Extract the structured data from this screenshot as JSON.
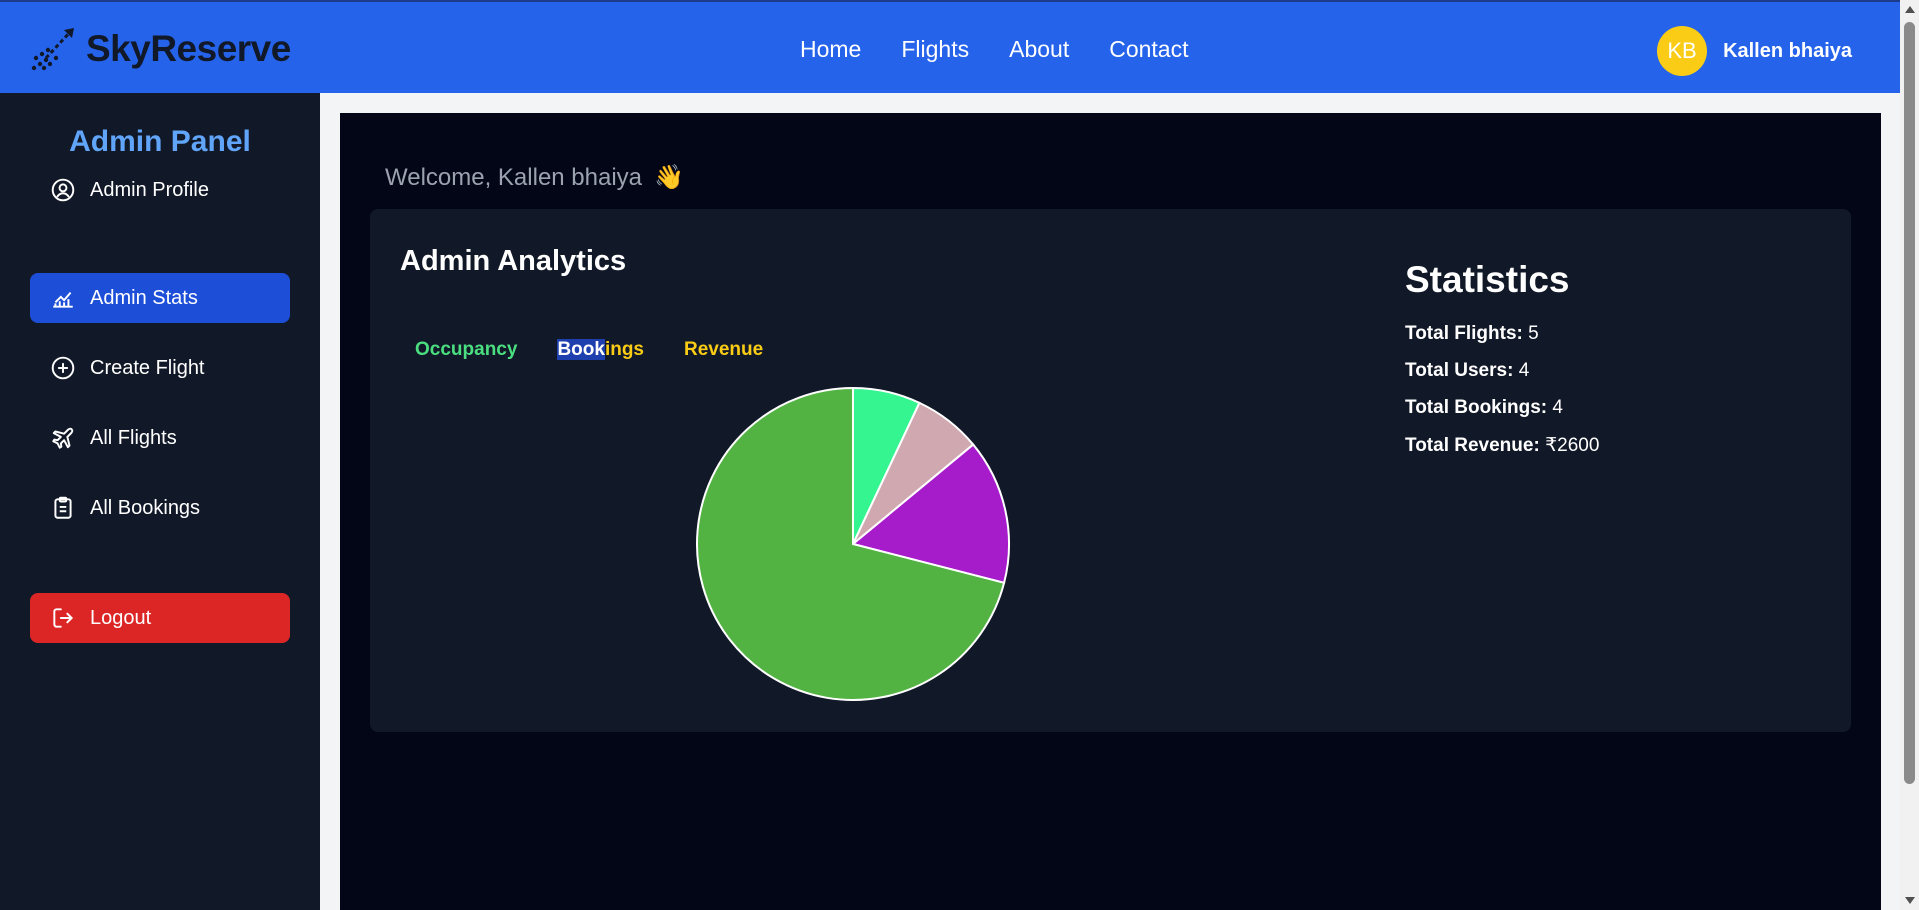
{
  "header": {
    "brand": "SkyReserve",
    "nav": [
      "Home",
      "Flights",
      "About",
      "Contact"
    ],
    "user_initials": "KB",
    "user_name": "Kallen bhaiya"
  },
  "sidebar": {
    "title": "Admin Panel",
    "items": [
      {
        "label": "Admin Profile",
        "icon": "user-circle-icon"
      },
      {
        "label": "Admin Stats",
        "icon": "chart-line-icon"
      },
      {
        "label": "Create Flight",
        "icon": "plus-circle-icon"
      },
      {
        "label": "All Flights",
        "icon": "plane-icon"
      },
      {
        "label": "All Bookings",
        "icon": "clipboard-icon"
      }
    ],
    "logout": "Logout"
  },
  "main": {
    "welcome": "Welcome, Kallen bhaiya",
    "wave": "👋",
    "card_title": "Admin Analytics",
    "tabs": {
      "occupancy": "Occupancy",
      "bookings_highlight": "Book",
      "bookings_rest": "ings",
      "revenue": "Revenue"
    }
  },
  "stats": {
    "title": "Statistics",
    "flights_label": "Total Flights:",
    "flights_value": "5",
    "users_label": "Total Users:",
    "users_value": "4",
    "bookings_label": "Total Bookings:",
    "bookings_value": "4",
    "revenue_label": "Total Revenue:",
    "revenue_value": "₹2600"
  },
  "colors": {
    "accent": "#2563eb",
    "sidebar": "#111827",
    "active": "#1d4ed8",
    "logout": "#dc2626"
  },
  "chart_data": {
    "type": "pie",
    "values": [
      7,
      7,
      15,
      71
    ],
    "colors": [
      "#34f58f",
      "#d0a8b0",
      "#a61ccb",
      "#52b343"
    ]
  }
}
